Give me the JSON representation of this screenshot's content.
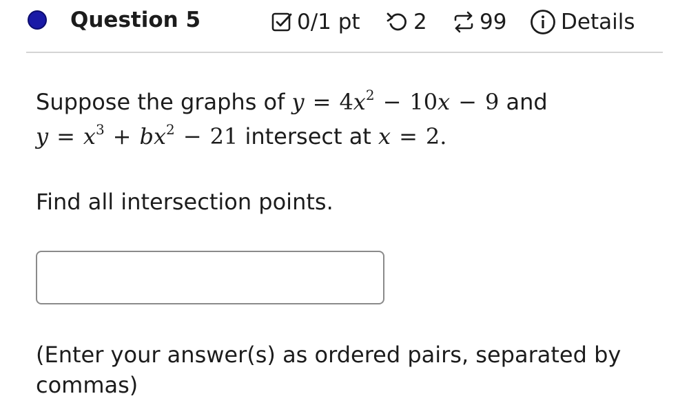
{
  "header": {
    "question_title": "Question 5",
    "score": "0/1 pt",
    "tries": "2",
    "submissions": "99",
    "details_label": "Details",
    "status_color": "#1a1aa6"
  },
  "question": {
    "line1": {
      "lead": "Suppose the graphs of",
      "y": "y",
      "eq": "=",
      "coef1": "4",
      "x1": "x",
      "exp1": "2",
      "minus1": "−",
      "coef2": "10",
      "x2": "x",
      "minus2": "−",
      "const": "9",
      "tail": "and"
    },
    "line2": {
      "y": "y",
      "eq": "=",
      "x1": "x",
      "exp1": "3",
      "plus": "+",
      "b": "b",
      "x2": "x",
      "exp2": "2",
      "minus": "−",
      "const": "21",
      "mid": "intersect at",
      "x3": "x",
      "eq2": "=",
      "val": "2."
    },
    "prompt": "Find all intersection points."
  },
  "answer": {
    "value": "",
    "placeholder": ""
  },
  "hint": "(Enter your answer(s) as ordered pairs, separated by commas)"
}
